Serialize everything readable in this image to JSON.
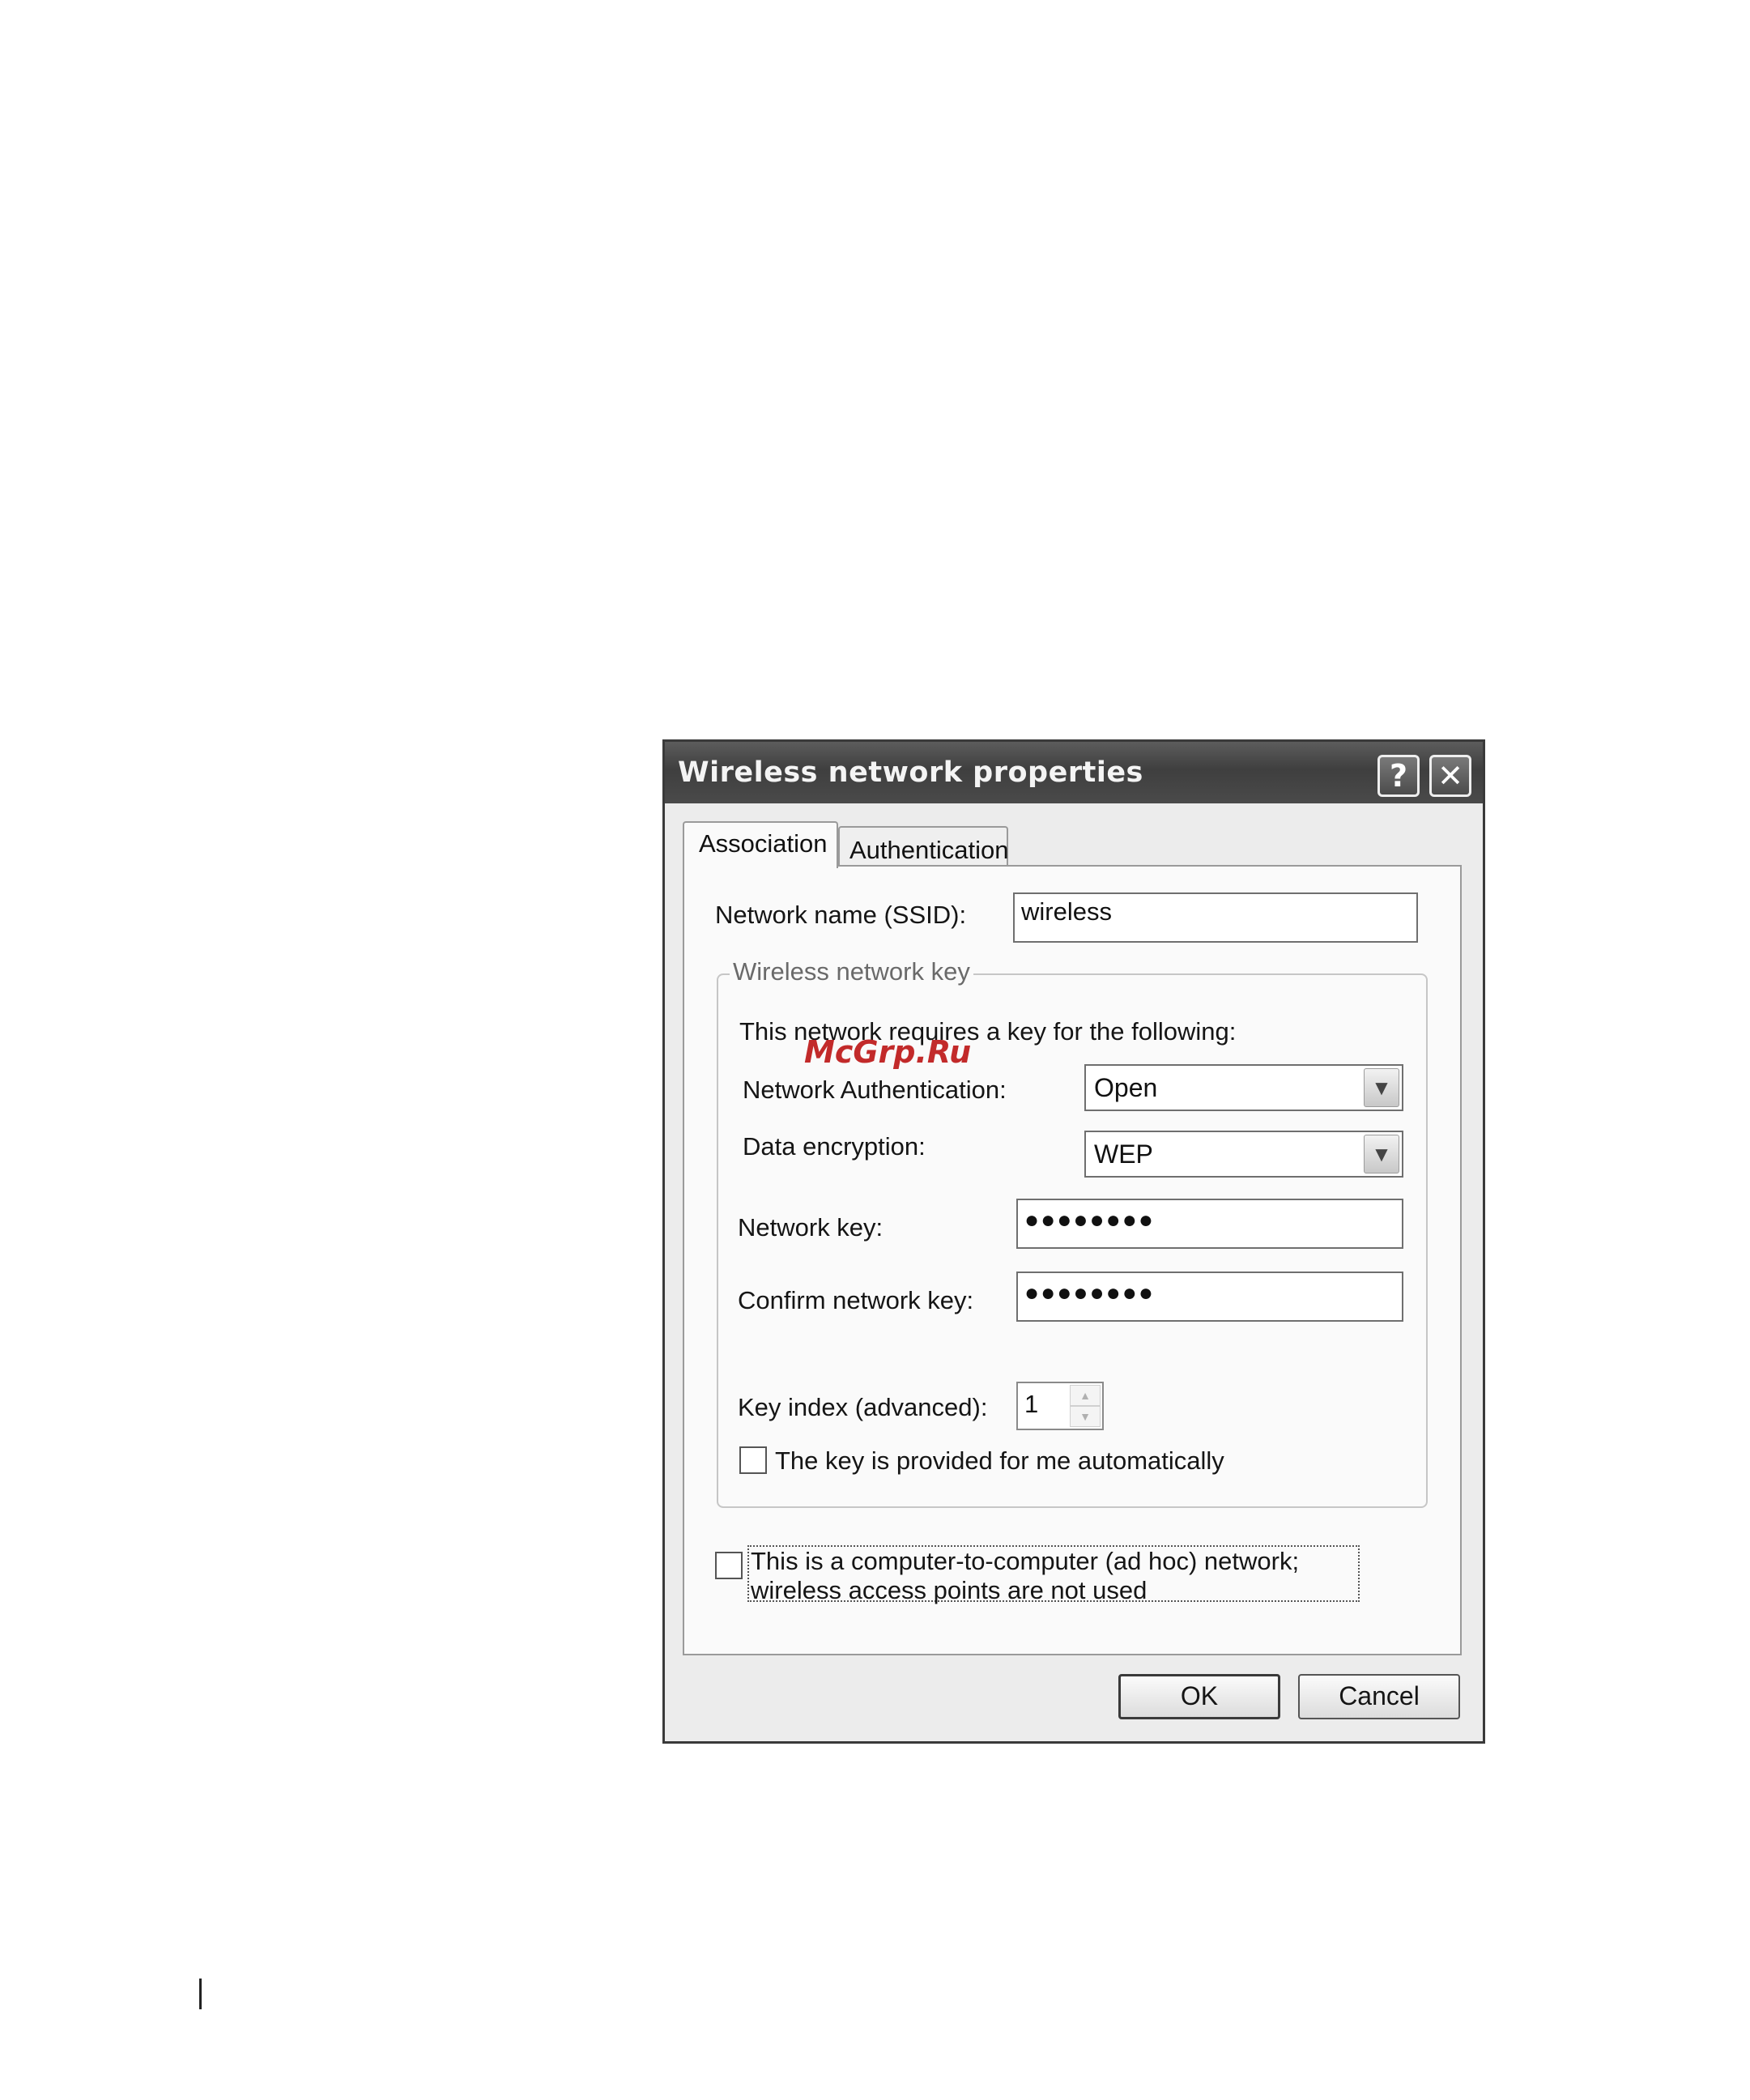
{
  "dialog": {
    "title": "Wireless network properties",
    "help_button": "?",
    "close_button": "✕"
  },
  "tabs": [
    {
      "label": "Association",
      "selected": true
    },
    {
      "label": "Authentication",
      "selected": false
    }
  ],
  "association": {
    "ssid_label": "Network name (SSID):",
    "ssid_value": "wireless",
    "group_title": "Wireless network key",
    "requires_key_text": "This network requires a key for the following:",
    "auth_label": "Network Authentication:",
    "auth_value": "Open",
    "encryption_label": "Data encryption:",
    "encryption_value": "WEP",
    "network_key_label": "Network key:",
    "network_key_value": "●●●●●●●●",
    "confirm_key_label": "Confirm network key:",
    "confirm_key_value": "●●●●●●●●",
    "key_index_label": "Key index (advanced):",
    "key_index_value": "1",
    "auto_key_label": "The key is provided for me automatically",
    "auto_key_checked": false,
    "adhoc_label": "This is a computer-to-computer (ad hoc) network; wireless access points are not used",
    "adhoc_checked": false
  },
  "buttons": {
    "ok": "OK",
    "cancel": "Cancel"
  },
  "watermark": "McGrp.Ru",
  "icons": {
    "dropdown": "chevron-down-icon",
    "spin_up": "arrow-up-icon",
    "spin_down": "arrow-down-icon"
  }
}
